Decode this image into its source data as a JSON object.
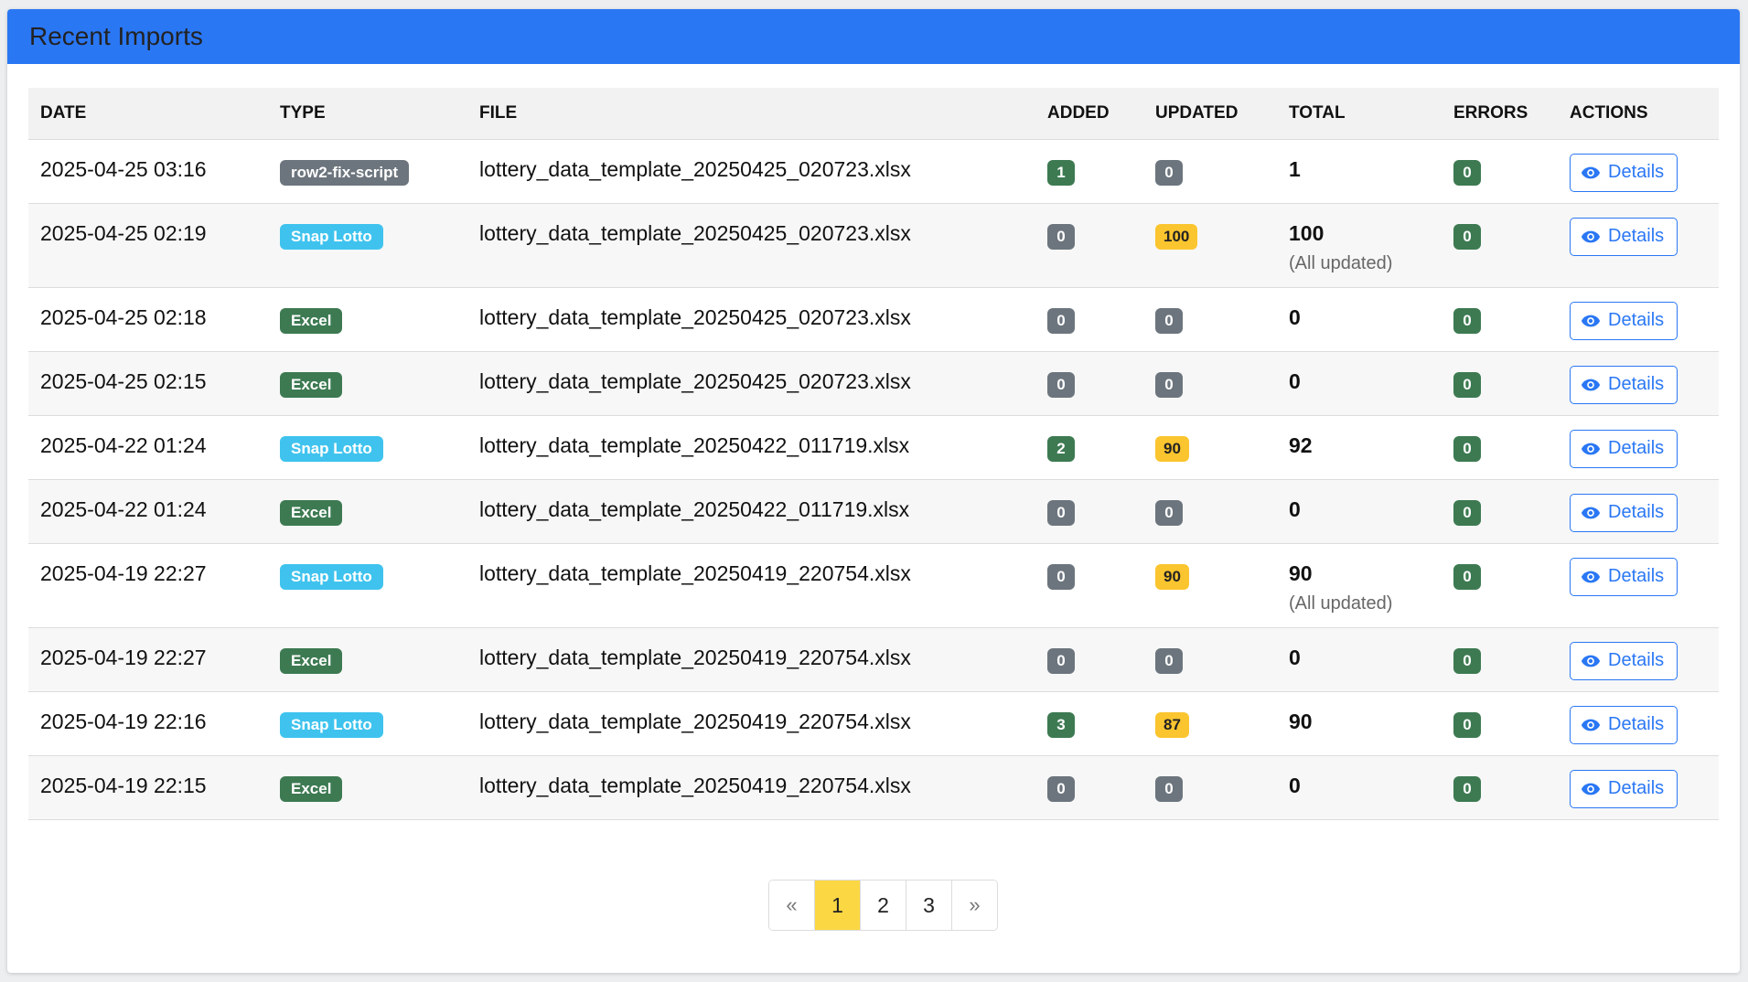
{
  "header": {
    "title": "Recent Imports"
  },
  "colors": {
    "header_bg": "#2a77f4",
    "type_dark": "#6c757d",
    "type_info": "#3fc3ee",
    "type_excel": "#3d7a52",
    "count_green": "#3d7a52",
    "count_gray": "#6c757d",
    "count_yellow": "#fbc52f",
    "active_page": "#fbd743",
    "details_blue": "#2a77f4"
  },
  "table": {
    "columns": [
      "DATE",
      "TYPE",
      "FILE",
      "ADDED",
      "UPDATED",
      "TOTAL",
      "ERRORS",
      "ACTIONS"
    ],
    "rows": [
      {
        "date": "2025-04-25 03:16",
        "type": "row2-fix-script",
        "type_style": "dark",
        "file": "lottery_data_template_20250425_020723.xlsx",
        "added": "1",
        "added_style": "green",
        "updated": "0",
        "updated_style": "gray",
        "total": "1",
        "total_note": "",
        "errors": "0",
        "action": "Details"
      },
      {
        "date": "2025-04-25 02:19",
        "type": "Snap Lotto",
        "type_style": "info",
        "file": "lottery_data_template_20250425_020723.xlsx",
        "added": "0",
        "added_style": "gray",
        "updated": "100",
        "updated_style": "yellow",
        "total": "100",
        "total_note": "(All updated)",
        "errors": "0",
        "action": "Details"
      },
      {
        "date": "2025-04-25 02:18",
        "type": "Excel",
        "type_style": "excel",
        "file": "lottery_data_template_20250425_020723.xlsx",
        "added": "0",
        "added_style": "gray",
        "updated": "0",
        "updated_style": "gray",
        "total": "0",
        "total_note": "",
        "errors": "0",
        "action": "Details"
      },
      {
        "date": "2025-04-25 02:15",
        "type": "Excel",
        "type_style": "excel",
        "file": "lottery_data_template_20250425_020723.xlsx",
        "added": "0",
        "added_style": "gray",
        "updated": "0",
        "updated_style": "gray",
        "total": "0",
        "total_note": "",
        "errors": "0",
        "action": "Details"
      },
      {
        "date": "2025-04-22 01:24",
        "type": "Snap Lotto",
        "type_style": "info",
        "file": "lottery_data_template_20250422_011719.xlsx",
        "added": "2",
        "added_style": "green",
        "updated": "90",
        "updated_style": "yellow",
        "total": "92",
        "total_note": "",
        "errors": "0",
        "action": "Details"
      },
      {
        "date": "2025-04-22 01:24",
        "type": "Excel",
        "type_style": "excel",
        "file": "lottery_data_template_20250422_011719.xlsx",
        "added": "0",
        "added_style": "gray",
        "updated": "0",
        "updated_style": "gray",
        "total": "0",
        "total_note": "",
        "errors": "0",
        "action": "Details"
      },
      {
        "date": "2025-04-19 22:27",
        "type": "Snap Lotto",
        "type_style": "info",
        "file": "lottery_data_template_20250419_220754.xlsx",
        "added": "0",
        "added_style": "gray",
        "updated": "90",
        "updated_style": "yellow",
        "total": "90",
        "total_note": "(All updated)",
        "errors": "0",
        "action": "Details"
      },
      {
        "date": "2025-04-19 22:27",
        "type": "Excel",
        "type_style": "excel",
        "file": "lottery_data_template_20250419_220754.xlsx",
        "added": "0",
        "added_style": "gray",
        "updated": "0",
        "updated_style": "gray",
        "total": "0",
        "total_note": "",
        "errors": "0",
        "action": "Details"
      },
      {
        "date": "2025-04-19 22:16",
        "type": "Snap Lotto",
        "type_style": "info",
        "file": "lottery_data_template_20250419_220754.xlsx",
        "added": "3",
        "added_style": "green",
        "updated": "87",
        "updated_style": "yellow",
        "total": "90",
        "total_note": "",
        "errors": "0",
        "action": "Details"
      },
      {
        "date": "2025-04-19 22:15",
        "type": "Excel",
        "type_style": "excel",
        "file": "lottery_data_template_20250419_220754.xlsx",
        "added": "0",
        "added_style": "gray",
        "updated": "0",
        "updated_style": "gray",
        "total": "0",
        "total_note": "",
        "errors": "0",
        "action": "Details"
      }
    ]
  },
  "pagination": {
    "prev": "«",
    "pages": [
      "1",
      "2",
      "3"
    ],
    "active": "1",
    "next": "»"
  },
  "icons": {
    "details": "eye-icon"
  }
}
